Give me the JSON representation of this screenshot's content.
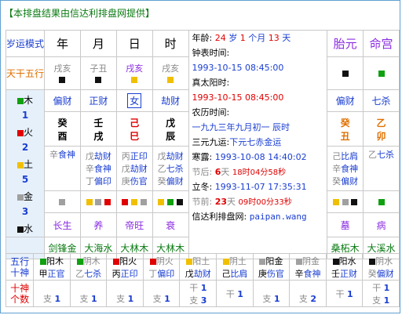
{
  "banner": "【本排盘结果由信达利排盘网提供】",
  "header": {
    "mode": "岁运模式",
    "year": "年",
    "month": "月",
    "day": "日",
    "hour": "时",
    "taiyuan": "胎元",
    "minggong": "命宫"
  },
  "row_labels": {
    "tiangan_wuxing": "天干五行",
    "wx_shi": "五行十神",
    "count": "十神个数"
  },
  "nayin_row_label": "",
  "wuxing_side": [
    {
      "glyph": "木",
      "count": "1"
    },
    {
      "glyph": "火",
      "count": "2"
    },
    {
      "glyph": "土",
      "count": "5"
    },
    {
      "glyph": "金",
      "count": "3"
    },
    {
      "glyph": "水",
      "count": "3"
    }
  ],
  "pillars": {
    "year": {
      "gz": "戌亥",
      "shishen": "偏财",
      "gan": "癸",
      "zhi": "酉",
      "canggan": [
        [
          "辛",
          "食神"
        ]
      ],
      "changsheng": "长生",
      "nayin": "剑锋金"
    },
    "month": {
      "gz": "子丑",
      "shishen": "正财",
      "gan": "壬",
      "zhi": "戌",
      "canggan": [
        [
          "戊",
          "劫财"
        ],
        [
          "辛",
          "食神"
        ],
        [
          "丁",
          "偏印"
        ]
      ],
      "changsheng": "养",
      "nayin": "大海水"
    },
    "day": {
      "gz": "戌亥",
      "shishen": "女",
      "gan": "己",
      "zhi": "巳",
      "canggan": [
        [
          "丙",
          "正印"
        ],
        [
          "戊",
          "劫财"
        ],
        [
          "庚",
          "伤官"
        ]
      ],
      "changsheng": "帝旺",
      "nayin": "大林木"
    },
    "hour": {
      "gz": "戌亥",
      "shishen": "劫财",
      "gan": "戊",
      "zhi": "辰",
      "canggan": [
        [
          "戊",
          "劫财"
        ],
        [
          "乙",
          "七杀"
        ],
        [
          "癸",
          "偏财"
        ]
      ],
      "changsheng": "衰",
      "nayin": "大林木"
    },
    "taiyuan": {
      "shishen": "偏财",
      "gan": "癸",
      "zhi": "丑",
      "canggan": [
        [
          "己",
          "比肩"
        ],
        [
          "辛",
          "食神"
        ],
        [
          "癸",
          "偏财"
        ]
      ],
      "changsheng": "墓",
      "nayin": "桑柘木"
    },
    "minggong": {
      "shishen": "七杀",
      "gan": "乙",
      "zhi": "卯",
      "canggan": [
        [
          "乙",
          "七杀"
        ]
      ],
      "changsheng": "病",
      "nayin": "大溪水"
    }
  },
  "info": {
    "age_label": "年龄:",
    "age_years": "24",
    "age_unit_years": "岁",
    "age_months": "1",
    "age_unit_months": "个月",
    "age_days": "13",
    "age_unit_days": "天",
    "clock_label": "钟表时间:",
    "clock_value": "1993-10-15 08:45:00",
    "solar_label": "真太阳时:",
    "solar_value": "1993-10-15 08:45:00",
    "lunar_label": "农历时间:",
    "lunar_value": "一九九三年九月初一 辰时",
    "sanyuan_label": "三元九运:",
    "sanyuan_value": "下元七赤金运",
    "hanlu_label": "寒露:",
    "hanlu_value": "1993-10-08 14:40:02",
    "jieqi_after_label": "节后:",
    "jieqi_after_days": "6",
    "jieqi_after_days_unit": "天",
    "jieqi_after_time": "18时04分58秒",
    "lidong_label": "立冬:",
    "lidong_value": "1993-11-07 17:35:31",
    "jieqi_before_label": "节前:",
    "jieqi_before_days": "23",
    "jieqi_before_days_unit": "天",
    "jieqi_before_time": "09时00分33秒",
    "site_label": "信达利排盘网:",
    "site_value": "paipan.wang"
  },
  "wuxing_shishen_row": [
    {
      "sq": "gr",
      "a": "阳木",
      "b": "甲",
      "c": "正官"
    },
    {
      "sq": "gr",
      "a": "阴木",
      "b": "乙",
      "c": "七杀"
    },
    {
      "sq": "rd",
      "a": "阳火",
      "b": "丙",
      "c": "正印"
    },
    {
      "sq": "rd",
      "a": "阴火",
      "b": "丁",
      "c": "偏印"
    },
    {
      "sq": "yl",
      "a": "阳土",
      "b": "戊",
      "c": "劫财"
    },
    {
      "sq": "yl",
      "a": "阴土",
      "b": "己",
      "c": "比肩"
    },
    {
      "sq": "gy",
      "a": "阳金",
      "b": "庚",
      "c": "伤官"
    },
    {
      "sq": "gy",
      "a": "阴金",
      "b": "辛",
      "c": "食神"
    },
    {
      "sq": "bk",
      "a": "阳水",
      "b": "壬",
      "c": "正财"
    },
    {
      "sq": "bk",
      "a": "阴水",
      "b": "癸",
      "c": "偏财"
    }
  ],
  "count_row": [
    {
      "g": "",
      "gn": "",
      "z": "支",
      "zn": "1"
    },
    {
      "g": "",
      "gn": "",
      "z": "支",
      "zn": "1"
    },
    {
      "g": "",
      "gn": "",
      "z": "支",
      "zn": "1"
    },
    {
      "g": "",
      "gn": "",
      "z": "支",
      "zn": "1"
    },
    {
      "g": "干",
      "gn": "1",
      "z": "支",
      "zn": "3"
    },
    {
      "g": "干",
      "gn": "1",
      "z": "",
      "zn": ""
    },
    {
      "g": "",
      "gn": "",
      "z": "支",
      "zn": "1"
    },
    {
      "g": "",
      "gn": "",
      "z": "支",
      "zn": "2"
    },
    {
      "g": "干",
      "gn": "1",
      "z": "",
      "zn": ""
    },
    {
      "g": "干",
      "gn": "1",
      "z": "支",
      "zn": "1"
    }
  ]
}
